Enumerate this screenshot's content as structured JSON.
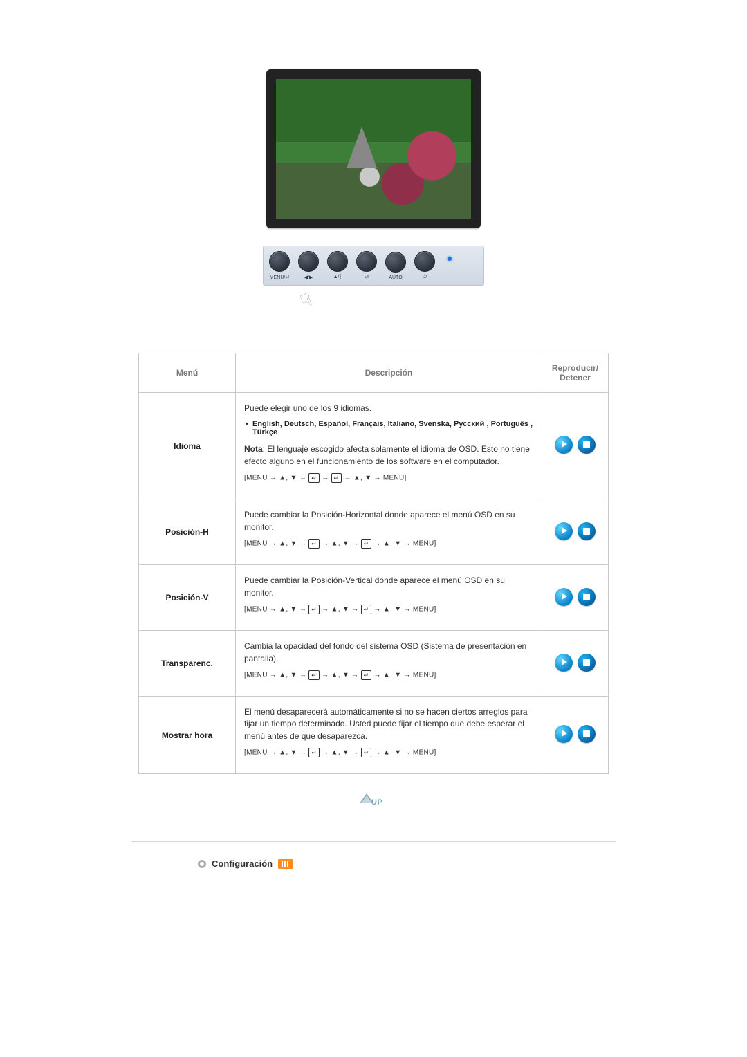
{
  "panel": {
    "buttons": [
      "MENU/⏎",
      "◀/▶",
      "▲/⏐",
      "⏎",
      "AUTO",
      "⏻"
    ]
  },
  "table": {
    "headers": {
      "menu": "Menú",
      "desc": "Descripción",
      "play": "Reproducir/\nDetener"
    },
    "rows": {
      "idioma": {
        "menu": "Idioma",
        "line1": "Puede elegir uno de los 9 idiomas.",
        "langs": "English, Deutsch, Español, Français,  Italiano, Svenska, Русский , Português , Türkçe",
        "nota_label": "Nota",
        "nota": ": El lenguaje escogido afecta solamente el idioma de OSD. Esto no tiene efecto alguno en el funcionamiento de los software en el computador."
      },
      "posh": {
        "menu": "Posición-H",
        "desc": "Puede cambiar la Posición-Horizontal donde aparece el menú OSD en su monitor."
      },
      "posv": {
        "menu": "Posición-V",
        "desc": "Puede cambiar la Posición-Vertical donde aparece el menú OSD en su monitor."
      },
      "transp": {
        "menu": "Transparenc.",
        "desc": "Cambia la opacidad del fondo del sistema OSD (Sistema de presentación en pantalla)."
      },
      "mostrar": {
        "menu": "Mostrar hora",
        "desc": "El menú desaparecerá automáticamente si no se hacen ciertos arreglos para fijar un tiempo determinado. Usted puede fijar el tiempo que debe esperar el menú antes de que desaparezca."
      }
    },
    "nav_parts": {
      "open": "[MENU → ",
      "updown": "▲, ▼",
      "arrow": " → ",
      "close": " → MENU]"
    }
  },
  "up_label": "UP",
  "section_title": "Configuración"
}
